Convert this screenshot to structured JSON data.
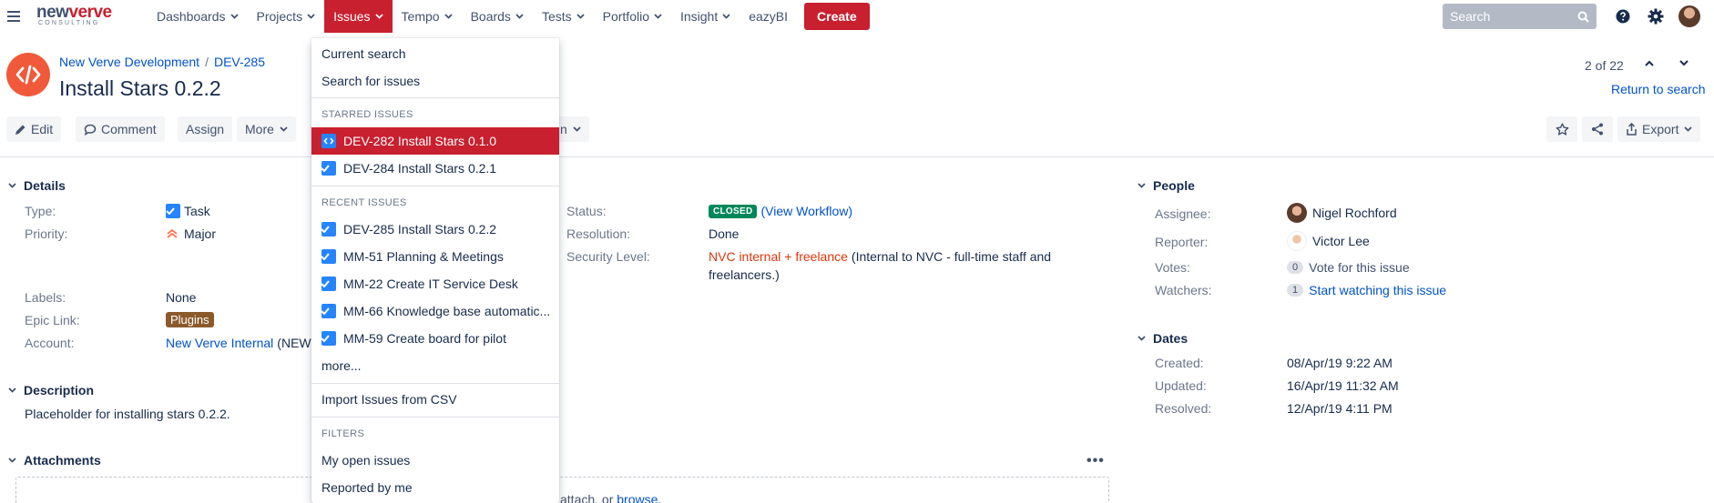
{
  "nav": {
    "logo_main_a": "new",
    "logo_main_b": "verve",
    "logo_sub": "CONSULTING",
    "items": [
      {
        "label": "Dashboards"
      },
      {
        "label": "Projects"
      },
      {
        "label": "Issues"
      },
      {
        "label": "Tempo"
      },
      {
        "label": "Boards"
      },
      {
        "label": "Tests"
      },
      {
        "label": "Portfolio"
      },
      {
        "label": "Insight"
      },
      {
        "label": "eazyBI"
      }
    ],
    "create_label": "Create",
    "search_placeholder": "Search"
  },
  "header": {
    "breadcrumb_project": "New Verve Development",
    "breadcrumb_sep": "/",
    "breadcrumb_issue": "DEV-285",
    "title": "Install Stars 0.2.2",
    "pager": "2 of 22",
    "return_label": "Return to search"
  },
  "toolbar": {
    "edit": "Edit",
    "comment": "Comment",
    "assign": "Assign",
    "more": "More",
    "workflow_tail": "n",
    "export": "Export"
  },
  "details": {
    "heading": "Details",
    "type_label": "Type:",
    "type_value": "Task",
    "priority_label": "Priority:",
    "priority_value": "Major",
    "labels_label": "Labels:",
    "labels_value": "None",
    "epic_label": "Epic Link:",
    "epic_value": "Plugins",
    "account_label": "Account:",
    "account_value": "New Verve Internal",
    "account_tail": "(NEWV",
    "status_label": "Status:",
    "status_value": "CLOSED",
    "view_workflow": "(View Workflow)",
    "resolution_label": "Resolution:",
    "resolution_value": "Done",
    "security_label": "Security Level:",
    "security_value": "NVC internal + freelance",
    "security_desc_1": "(Internal to NVC - full-time staff and",
    "security_desc_2": "freelancers.)"
  },
  "description": {
    "heading": "Description",
    "text": "Placeholder for installing stars 0.2.2."
  },
  "attachments": {
    "heading": "Attachments",
    "more": "•••",
    "drop_text": "attach, or",
    "browse": "browse."
  },
  "people": {
    "heading": "People",
    "assignee_label": "Assignee:",
    "assignee_value": "Nigel Rochford",
    "reporter_label": "Reporter:",
    "reporter_value": "Victor Lee",
    "votes_label": "Votes:",
    "votes_count": "0",
    "votes_action": "Vote for this issue",
    "watchers_label": "Watchers:",
    "watchers_count": "1",
    "watchers_action": "Start watching this issue"
  },
  "dates": {
    "heading": "Dates",
    "created_label": "Created:",
    "created_value": "08/Apr/19 9:22 AM",
    "updated_label": "Updated:",
    "updated_value": "16/Apr/19 11:32 AM",
    "resolved_label": "Resolved:",
    "resolved_value": "12/Apr/19 4:11 PM"
  },
  "dropdown": {
    "current_search": "Current search",
    "search_for_issues": "Search for issues",
    "starred_heading": "STARRED ISSUES",
    "starred": [
      {
        "label": "DEV-282 Install Stars 0.1.0"
      },
      {
        "label": "DEV-284 Install Stars 0.2.1"
      }
    ],
    "recent_heading": "RECENT ISSUES",
    "recent": [
      {
        "label": "DEV-285 Install Stars 0.2.2"
      },
      {
        "label": "MM-51 Planning & Meetings"
      },
      {
        "label": "MM-22 Create IT Service Desk"
      },
      {
        "label": "MM-66 Knowledge base automatic..."
      },
      {
        "label": "MM-59 Create board for pilot"
      }
    ],
    "more": "more...",
    "import_csv": "Import Issues from CSV",
    "filters_heading": "FILTERS",
    "filters": [
      {
        "label": "My open issues"
      },
      {
        "label": "Reported by me"
      }
    ]
  },
  "colors": {
    "brand_red": "#c8202f",
    "link_blue": "#0052cc",
    "status_green": "#00875a"
  }
}
